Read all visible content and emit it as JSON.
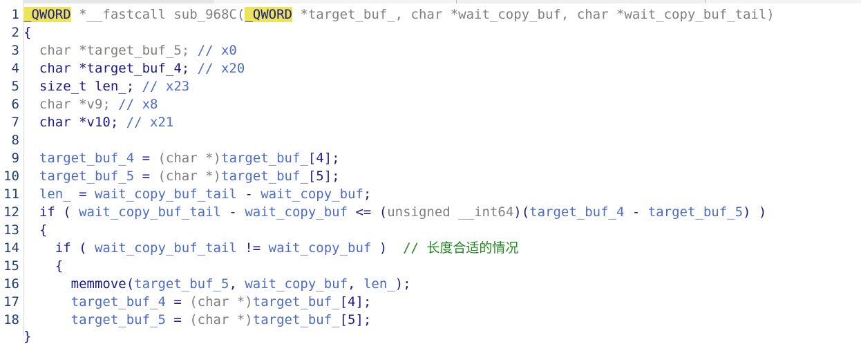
{
  "colors": {
    "keyword": "#1a1a8c",
    "identifier": "#4c6cc8",
    "gray_type": "#7f7f7f",
    "comment_green": "#1f8a1f",
    "highlight": "#ece45a",
    "line_number": "#1e3a6e"
  },
  "lines": [
    {
      "n": "1",
      "tokens": [
        {
          "t": "_QWORD",
          "c": "hl"
        },
        {
          "t": " *__fastcall sub_968C(",
          "c": "gray"
        },
        {
          "t": "_QWORD",
          "c": "hl"
        },
        {
          "t": " *target_buf_, char *wait_copy_buf, char *wait_copy_buf_tail)",
          "c": "gray"
        }
      ]
    },
    {
      "n": "2",
      "tokens": [
        {
          "t": "{",
          "c": "kw"
        }
      ]
    },
    {
      "n": "3",
      "tokens": [
        {
          "t": "  char *target_buf_5; ",
          "c": "gray"
        },
        {
          "t": "// x0",
          "c": "cm"
        }
      ]
    },
    {
      "n": "4",
      "tokens": [
        {
          "t": "  char *target_buf_4; ",
          "c": "kw"
        },
        {
          "t": "// x20",
          "c": "cm"
        }
      ]
    },
    {
      "n": "5",
      "tokens": [
        {
          "t": "  size_t len_; ",
          "c": "kw"
        },
        {
          "t": "// x23",
          "c": "cm"
        }
      ]
    },
    {
      "n": "6",
      "tokens": [
        {
          "t": "  char *v9; ",
          "c": "gray"
        },
        {
          "t": "// x8",
          "c": "cm"
        }
      ]
    },
    {
      "n": "7",
      "tokens": [
        {
          "t": "  char *v10; ",
          "c": "kw"
        },
        {
          "t": "// x21",
          "c": "cm"
        }
      ]
    },
    {
      "n": "8",
      "tokens": []
    },
    {
      "n": "9",
      "tokens": [
        {
          "t": "  target_buf_4",
          "c": "id"
        },
        {
          "t": " = ",
          "c": "kw"
        },
        {
          "t": "(char *)",
          "c": "gray"
        },
        {
          "t": "target_buf_",
          "c": "id"
        },
        {
          "t": "[4];",
          "c": "kw"
        }
      ]
    },
    {
      "n": "10",
      "tokens": [
        {
          "t": "  target_buf_5",
          "c": "id"
        },
        {
          "t": " = ",
          "c": "kw"
        },
        {
          "t": "(char *)",
          "c": "gray"
        },
        {
          "t": "target_buf_",
          "c": "id"
        },
        {
          "t": "[5];",
          "c": "kw"
        }
      ]
    },
    {
      "n": "11",
      "tokens": [
        {
          "t": "  len_",
          "c": "id"
        },
        {
          "t": " = ",
          "c": "kw"
        },
        {
          "t": "wait_copy_buf_tail",
          "c": "id"
        },
        {
          "t": " - ",
          "c": "kw"
        },
        {
          "t": "wait_copy_buf",
          "c": "id"
        },
        {
          "t": ";",
          "c": "kw"
        }
      ]
    },
    {
      "n": "12",
      "tokens": [
        {
          "t": "  if ( ",
          "c": "kw"
        },
        {
          "t": "wait_copy_buf_tail",
          "c": "id"
        },
        {
          "t": " - ",
          "c": "kw"
        },
        {
          "t": "wait_copy_buf",
          "c": "id"
        },
        {
          "t": " <= (",
          "c": "kw"
        },
        {
          "t": "unsigned __int64",
          "c": "gray"
        },
        {
          "t": ")(",
          "c": "kw"
        },
        {
          "t": "target_buf_4",
          "c": "id"
        },
        {
          "t": " - ",
          "c": "kw"
        },
        {
          "t": "target_buf_5",
          "c": "id"
        },
        {
          "t": ") )",
          "c": "kw"
        }
      ]
    },
    {
      "n": "13",
      "tokens": [
        {
          "t": "  {",
          "c": "kw"
        }
      ]
    },
    {
      "n": "14",
      "tokens": [
        {
          "t": "    if ( ",
          "c": "kw"
        },
        {
          "t": "wait_copy_buf_tail",
          "c": "id"
        },
        {
          "t": " != ",
          "c": "kw"
        },
        {
          "t": "wait_copy_buf",
          "c": "id"
        },
        {
          "t": " )  ",
          "c": "kw"
        },
        {
          "t": "// 长度合适的情况",
          "c": "cmg"
        }
      ]
    },
    {
      "n": "15",
      "tokens": [
        {
          "t": "    {",
          "c": "kw"
        }
      ]
    },
    {
      "n": "16",
      "tokens": [
        {
          "t": "      memmove(",
          "c": "kw"
        },
        {
          "t": "target_buf_5",
          "c": "id"
        },
        {
          "t": ", ",
          "c": "kw"
        },
        {
          "t": "wait_copy_buf",
          "c": "id"
        },
        {
          "t": ", ",
          "c": "kw"
        },
        {
          "t": "len_",
          "c": "id"
        },
        {
          "t": ");",
          "c": "kw"
        }
      ]
    },
    {
      "n": "17",
      "tokens": [
        {
          "t": "      target_buf_4",
          "c": "id"
        },
        {
          "t": " = ",
          "c": "kw"
        },
        {
          "t": "(char *)",
          "c": "gray"
        },
        {
          "t": "target_buf_",
          "c": "id"
        },
        {
          "t": "[4];",
          "c": "kw"
        }
      ]
    },
    {
      "n": "18",
      "tokens": [
        {
          "t": "      target_buf_5",
          "c": "id"
        },
        {
          "t": " = ",
          "c": "kw"
        },
        {
          "t": "(char *)",
          "c": "gray"
        },
        {
          "t": "target_buf_",
          "c": "id"
        },
        {
          "t": "[5];",
          "c": "kw"
        }
      ]
    }
  ],
  "partial_line": "    }"
}
